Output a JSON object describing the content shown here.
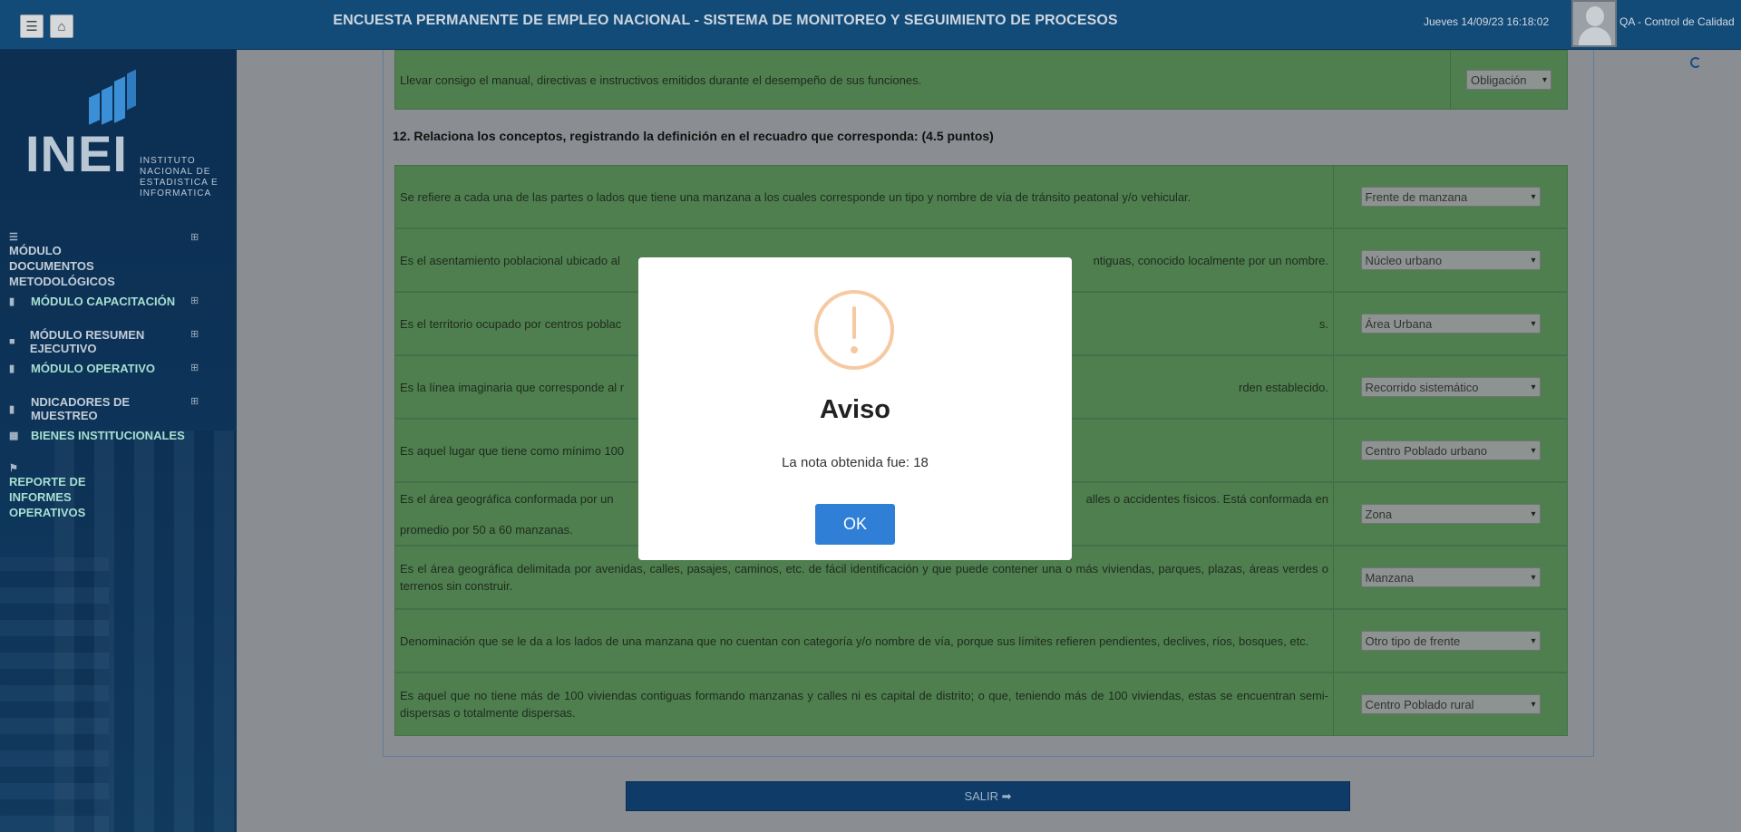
{
  "header": {
    "title": "ENCUESTA PERMANENTE DE EMPLEO NACIONAL - SISTEMA DE MONITOREO Y SEGUIMIENTO DE PROCESOS",
    "datetime": "Jueves 14/09/23 16:18:02",
    "user": "QA - Control de Calidad",
    "menu_icon": "☰",
    "home_icon": "⌂"
  },
  "logo": {
    "name": "INEI",
    "subtitle": "INSTITUTO NACIONAL DE ESTADISTICA E INFORMATICA"
  },
  "sidebar": {
    "items": [
      {
        "label": "MÓDULO DOCUMENTOS METODOLÓGICOS",
        "icon": "database-icon"
      },
      {
        "label": "MÓDULO CAPACITACIÓN",
        "icon": "bar-chart-icon"
      },
      {
        "label": "MÓDULO RESUMEN EJECUTIVO",
        "icon": "briefcase-icon"
      },
      {
        "label": "MÓDULO OPERATIVO",
        "icon": "bar-chart-icon"
      },
      {
        "label": "NDICADORES DE MUESTREO",
        "icon": "bar-chart-icon"
      },
      {
        "label": "BIENES INSTITUCIONALES",
        "icon": "table-icon"
      },
      {
        "label": "REPORTE DE INFORMES OPERATIVOS",
        "icon": "flag-icon"
      }
    ],
    "expand_glyph": "⊞"
  },
  "content": {
    "prev_row": {
      "text": "Llevar consigo el manual, directivas e instructivos emitidos durante el desempeño de sus funciones.",
      "value": "Obligación"
    },
    "question_12": "12.  Relaciona los conceptos, registrando la definición en el recuadro que corresponda: (4.5 puntos)",
    "rows": [
      {
        "text": "Se refiere a cada una de las partes o lados que tiene una manzana a los cuales corresponde un tipo y nombre de vía de tránsito peatonal y/o vehicular.",
        "value": "Frente de manzana"
      },
      {
        "text": "Es el asentamiento poblacional ubicado al",
        "text_right": "ntiguas, conocido localmente por un nombre.",
        "value": "Núcleo urbano"
      },
      {
        "text": "Es el territorio ocupado por centros poblac",
        "text_right": "s.",
        "value": "Área Urbana"
      },
      {
        "text": "Es la línea imaginaria que corresponde al r",
        "text_right": "rden establecido.",
        "value": "Recorrido sistemático"
      },
      {
        "text": "Es aquel lugar que tiene como mínimo 100",
        "text_right": "",
        "value": "Centro Poblado urbano"
      },
      {
        "text": " Es el área geográfica conformada por un",
        "text_right": "alles o accidentes físicos. Está conformada en",
        "text_line2": "promedio por 50 a 60 manzanas.",
        "value": "Zona"
      },
      {
        "text": " Es el área geográfica delimitada por avenidas, calles, pasajes, caminos, etc. de fácil identificación y que puede contener una o más viviendas, parques, plazas, áreas verdes o terrenos sin construir.",
        "value": "Manzana"
      },
      {
        "text": " Denominación que se le da a los lados de una manzana que no cuentan con categoría y/o nombre de vía, porque sus límites refieren pendientes, declives, ríos, bosques, etc.",
        "value": "Otro tipo de frente"
      },
      {
        "text": " Es aquel que no tiene más de 100 viviendas contiguas formando manzanas y calles ni es capital de distrito; o que, teniendo más de 100 viviendas, estas se encuentran semi-dispersas o totalmente dispersas.",
        "value": "Centro Poblado rural"
      }
    ],
    "exit_label": "SALIR ➡"
  },
  "modal": {
    "title": "Aviso",
    "message": "La nota obtenida fue: 18",
    "ok_label": "OK",
    "icon": "warning-icon",
    "icon_color": "#f6c9a0",
    "button_color": "#2f7fd6"
  },
  "colors": {
    "header_bg": "#124a78",
    "row_green": "#4f7f4f",
    "sidebar_bg": "#0d3358"
  }
}
